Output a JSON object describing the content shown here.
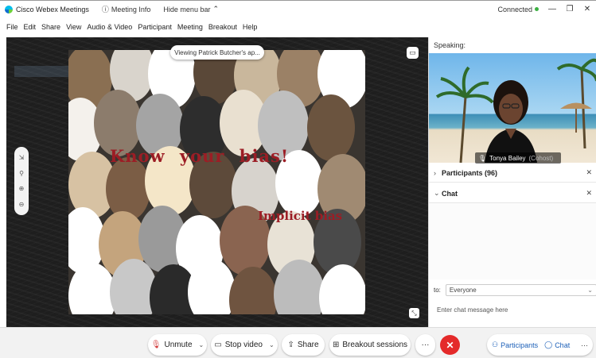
{
  "titlebar": {
    "app_name": "Cisco Webex Meetings",
    "meeting_info": "Meeting Info",
    "hide_menu": "Hide menu bar",
    "connected": "Connected"
  },
  "menu": [
    "File",
    "Edit",
    "Share",
    "View",
    "Audio & Video",
    "Participant",
    "Meeting",
    "Breakout",
    "Help"
  ],
  "share": {
    "viewing_label": "Viewing Patrick Butcher's ap...",
    "title_text": "Know your bias!",
    "subtitle_text": "Implicit bias"
  },
  "panel": {
    "speaking_label": "Speaking:",
    "speaker_name": "Tonya Bailey",
    "speaker_role": "(Cohost)",
    "participants_label": "Participants (96)",
    "chat_label": "Chat",
    "to_label": "to:",
    "to_value": "Everyone",
    "chat_placeholder": "Enter chat message here"
  },
  "toolbar": {
    "unmute": "Unmute",
    "stop_video": "Stop video",
    "share": "Share",
    "breakout": "Breakout sessions",
    "participants": "Participants",
    "chat": "Chat"
  },
  "colors": {
    "leave_red": "#e42a2a",
    "accent_blue": "#1b5fb8",
    "title_red": "#9c1d25"
  }
}
